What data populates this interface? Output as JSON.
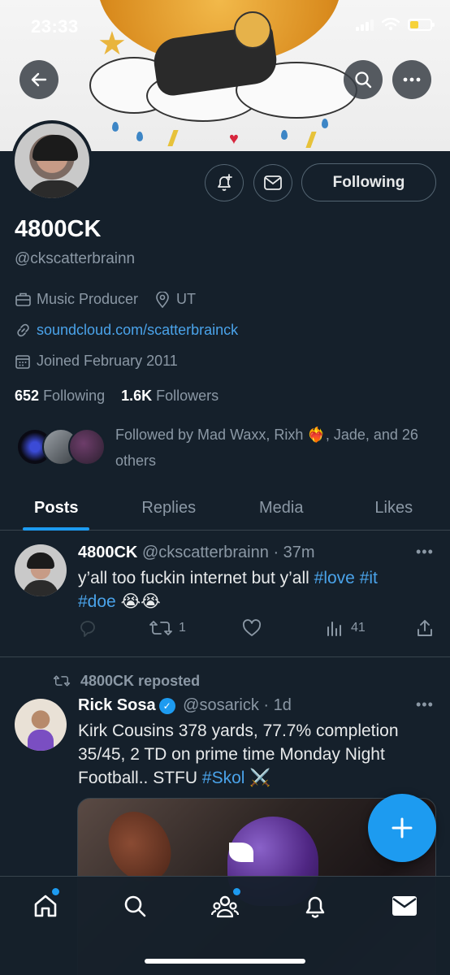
{
  "status_bar": {
    "time": "23:33"
  },
  "profile": {
    "display_name": "4800CK",
    "handle": "@ckscatterbrainn",
    "profession": "Music Producer",
    "location": "UT",
    "website": "soundcloud.com/scatterbrainck",
    "joined": "Joined February 2011",
    "following_count": "652",
    "following_label": "Following",
    "followers_count": "1.6K",
    "followers_label": "Followers",
    "followed_by_text": "Followed by Mad Waxx, Rixh ❤️‍🔥, Jade, and 26 others",
    "follow_button_label": "Following"
  },
  "tabs": [
    {
      "label": "Posts",
      "active": true
    },
    {
      "label": "Replies",
      "active": false
    },
    {
      "label": "Media",
      "active": false
    },
    {
      "label": "Likes",
      "active": false
    }
  ],
  "posts": [
    {
      "author": "4800CK",
      "handle": "@ckscatterbrainn",
      "time": "· 37m",
      "text_plain": "y’all too fuckin internet but y’all ",
      "hashtag_1": "#love",
      "hashtag_2": "#it",
      "hashtag_3": "#doe",
      "emoji": "😭😭",
      "replies": "",
      "reposts": "1",
      "likes": "",
      "views": "41"
    },
    {
      "reposted_by": "4800CK reposted",
      "author": "Rick Sosa",
      "handle": "@sosarick",
      "time": "· 1d",
      "text_plain": "Kirk Cousins 378 yards, 77.7% completion 35/45, 2 TD on prime time Monday Night Football.. STFU ",
      "hashtag": "#Skol",
      "emoji": "⚔️"
    }
  ],
  "colors": {
    "background": "#15202b",
    "accent": "#1d9bf0",
    "muted": "#8b98a5",
    "link": "#4aa3ea",
    "battery": "#f6d23b"
  },
  "icons": [
    "back-arrow-icon",
    "search-icon",
    "more-icon",
    "notification-add-icon",
    "mail-icon",
    "briefcase-icon",
    "location-pin-icon",
    "link-icon",
    "calendar-icon",
    "reply-icon",
    "repost-icon",
    "like-icon",
    "views-icon",
    "share-icon",
    "plus-icon",
    "home-icon",
    "communities-icon",
    "bell-icon",
    "messages-icon"
  ]
}
